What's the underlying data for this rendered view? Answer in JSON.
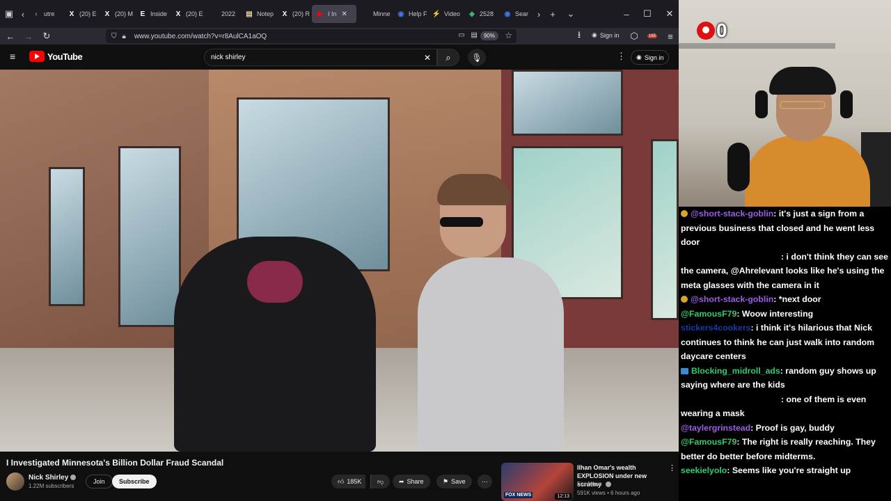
{
  "tabs": [
    {
      "label": "utre",
      "icon": "‹",
      "color": "#888888"
    },
    {
      "label": "(20) E",
      "icon": "X",
      "color": "#ffffff"
    },
    {
      "label": "(20) M",
      "icon": "X",
      "color": "#ffffff"
    },
    {
      "label": "Inside",
      "icon": "E",
      "color": "#ffffff"
    },
    {
      "label": "(20) E",
      "icon": "X",
      "color": "#ffffff"
    },
    {
      "label": "2022",
      "icon": "",
      "color": "#888888"
    },
    {
      "label": "Notep",
      "icon": "▤",
      "color": "#e3d4a0"
    },
    {
      "label": "(20) R",
      "icon": "X",
      "color": "#ffffff"
    },
    {
      "label": "I In",
      "icon": "▶",
      "color": "#ff0000",
      "active": true
    },
    {
      "label": "Minne",
      "icon": "",
      "color": "#888888"
    },
    {
      "label": "Help F",
      "icon": "◉",
      "color": "#3e7be6"
    },
    {
      "label": "Video",
      "icon": "⚡",
      "color": "#8a3be0"
    },
    {
      "label": "2528",
      "icon": "◆",
      "color": "#3cb371"
    },
    {
      "label": "Sear",
      "icon": "◉",
      "color": "#3e7be6"
    }
  ],
  "browser": {
    "url": "www.youtube.com/watch?v=r8AulCA1aOQ",
    "zoom": "90%",
    "signin": "Sign in",
    "notif_count": "165"
  },
  "youtube": {
    "logo": "YouTube",
    "search_value": "nick shirley",
    "signin": "Sign in"
  },
  "video": {
    "title": "I Investigated Minnesota's Billion Dollar Fraud Scandal",
    "channel": "Nick Shirley",
    "subscribers": "1.22M subscribers",
    "join": "Join",
    "subscribe": "Subscribe",
    "likes": "185K",
    "share": "Share",
    "save": "Save"
  },
  "recommendation": {
    "title": "Ilhan Omar's wealth EXPLOSION under new scrutiny",
    "channel": "Fox News",
    "meta": "591K views • 6 hours ago",
    "duration": "12:13",
    "badge": "FOX NEWS"
  },
  "webcam": {
    "counter": "0"
  },
  "chat": [
    {
      "badge": "gold",
      "user": "@short-stack-goblin",
      "user_color": "#9b5de5",
      "text": ": it's just a sign from a previous business that closed and he went less door"
    },
    {
      "badge": "",
      "user": "",
      "user_color": "#000000",
      "text": ": i don't think they can see the camera, @Ahrelevant looks like he's using the meta glasses with the camera in it"
    },
    {
      "badge": "gold",
      "user": "@short-stack-goblin",
      "user_color": "#9b5de5",
      "text": ": *next door"
    },
    {
      "badge": "",
      "user": "@FamousF79",
      "user_color": "#2ecc71",
      "text": ": Woow interesting"
    },
    {
      "badge": "",
      "user": "stickers4cookers",
      "user_color": "#1a3aa8",
      "text": ": i think it's hilarious that Nick continues to think he can just walk into random daycare centers"
    },
    {
      "badge": "blue",
      "user": "Blocking_midroll_ads",
      "user_color": "#2ecc71",
      "text": ": random guy shows up saying where are the kids"
    },
    {
      "badge": "",
      "user": "",
      "user_color": "#000000",
      "text": ": one of them is even wearing a mask"
    },
    {
      "badge": "",
      "user": "@taylergrinstead",
      "user_color": "#9b5de5",
      "text": ": Proof is gay, buddy"
    },
    {
      "badge": "",
      "user": "@FamousF79",
      "user_color": "#2ecc71",
      "text": ": The right is really reaching. They better do better before midterms."
    },
    {
      "badge": "",
      "user": "seekielyolo",
      "user_color": "#2ecc71",
      "text": ": Seems like you're straight up"
    }
  ]
}
